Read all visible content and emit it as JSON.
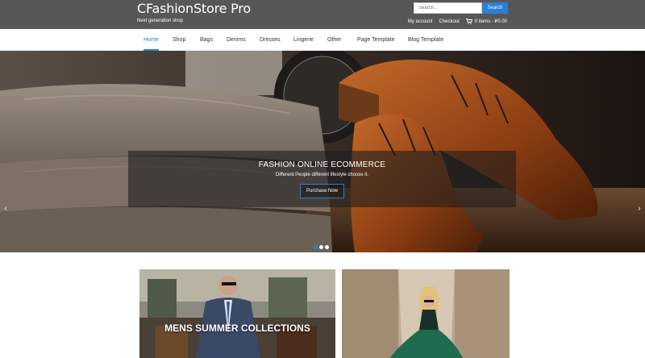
{
  "header": {
    "site_title": "CFashionStore Pro",
    "tagline": "Next generation shop",
    "search": {
      "placeholder": "Search...",
      "button_label": "Search"
    },
    "links": {
      "my_account": "My account",
      "checkout": "Checkout",
      "cart": "0 items - ₽0.00"
    }
  },
  "nav": {
    "items": [
      {
        "label": "Home"
      },
      {
        "label": "Shop"
      },
      {
        "label": "Bags"
      },
      {
        "label": "Denims"
      },
      {
        "label": "Dresses"
      },
      {
        "label": "Lingerie"
      },
      {
        "label": "Other"
      },
      {
        "label": "Page Template"
      },
      {
        "label": "Blog Template"
      }
    ]
  },
  "hero": {
    "title": "FASHION ONLINE ECOMMERCE",
    "subtitle": "Different People different lifestyle choose it.",
    "button_label": "Purchase Now",
    "prev_arrow": "‹",
    "next_arrow": "›"
  },
  "cards": [
    {
      "label": "MENS SUMMER COLLECTIONS"
    },
    {
      "label": ""
    }
  ],
  "colors": {
    "accent": "#2b7fd4",
    "header_bg": "#575757"
  }
}
